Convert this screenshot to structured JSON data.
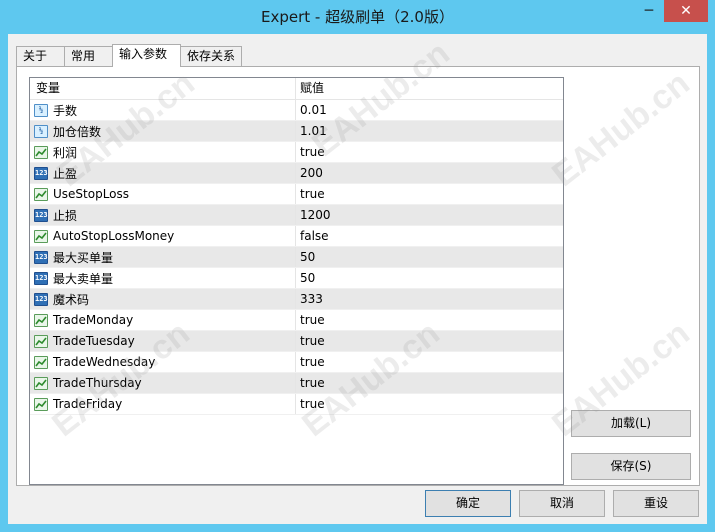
{
  "window": {
    "title": "Expert - 超级刷单（2.0版）",
    "minimize_glyph": "─",
    "close_glyph": "✕"
  },
  "tabs": [
    {
      "label": "关于"
    },
    {
      "label": "常用"
    },
    {
      "label": "输入参数",
      "active": true
    },
    {
      "label": "依存关系"
    }
  ],
  "grid": {
    "headers": {
      "variable": "变量",
      "value": "赋值"
    },
    "rows": [
      {
        "icon": "double-icon",
        "name": "手数",
        "value": "0.01"
      },
      {
        "icon": "double-icon",
        "name": "加仓倍数",
        "value": "1.01"
      },
      {
        "icon": "bool-icon",
        "name": "利润",
        "value": "true"
      },
      {
        "icon": "int-icon",
        "name": "止盈",
        "value": "200"
      },
      {
        "icon": "bool-icon",
        "name": "UseStopLoss",
        "value": "true"
      },
      {
        "icon": "int-icon",
        "name": "止损",
        "value": "1200"
      },
      {
        "icon": "bool-icon",
        "name": "AutoStopLossMoney",
        "value": "false"
      },
      {
        "icon": "int-icon",
        "name": "最大买单量",
        "value": "50"
      },
      {
        "icon": "int-icon",
        "name": "最大卖单量",
        "value": "50"
      },
      {
        "icon": "int-icon",
        "name": "魔术码",
        "value": "333"
      },
      {
        "icon": "bool-icon",
        "name": "TradeMonday",
        "value": "true"
      },
      {
        "icon": "bool-icon",
        "name": "TradeTuesday",
        "value": "true"
      },
      {
        "icon": "bool-icon",
        "name": "TradeWednesday",
        "value": "true"
      },
      {
        "icon": "bool-icon",
        "name": "TradeThursday",
        "value": "true"
      },
      {
        "icon": "bool-icon",
        "name": "TradeFriday",
        "value": "true"
      }
    ]
  },
  "icon_text": {
    "double": "½",
    "int": "123"
  },
  "buttons": {
    "load": "加载(L)",
    "save": "保存(S)",
    "ok": "确定",
    "cancel": "取消",
    "reset": "重设"
  },
  "watermark": "EAHub.cn",
  "colors": {
    "titlebar": "#5ec8ef",
    "close": "#c7504c"
  }
}
